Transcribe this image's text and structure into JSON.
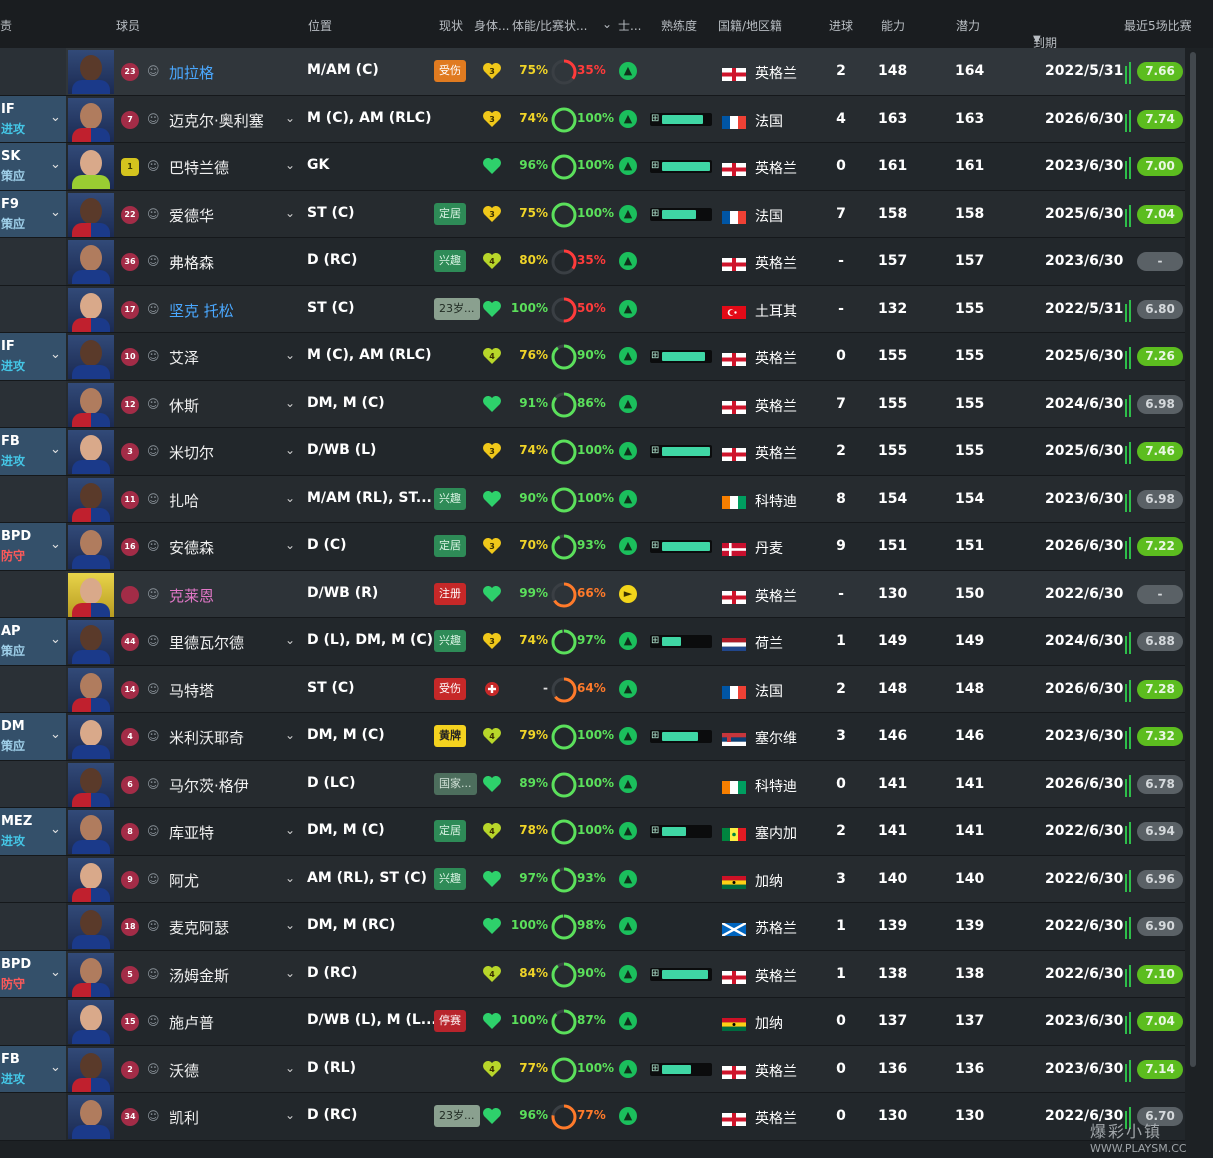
{
  "header": {
    "col_role": "责",
    "col_player": "球员",
    "col_position": "位置",
    "col_status": "现状",
    "col_body": "身体...",
    "col_condition": "体能/比赛状...",
    "col_morale": "士...",
    "col_familiarity": "熟练度",
    "col_nationality": "国籍/地区籍",
    "col_goals": "进球",
    "col_ca": "能力",
    "col_pa": "潜力",
    "col_expiry": "到期",
    "col_last5": "最近5场比赛"
  },
  "colors": {
    "rating_green": "#5cbd1f",
    "rating_grey": "#5a6166",
    "condition_green": "#5be05b",
    "condition_yellow": "#f0d428",
    "sharpness_red": "#ff3b3b",
    "link_blue": "#4aa8ff",
    "loan_pink": "#e077c6"
  },
  "players": [
    {
      "role": "",
      "role_mode": "",
      "number": "23",
      "name": "加拉格",
      "pos": "M/AM (C)",
      "status": "受伤",
      "body": "3",
      "cond": "75%",
      "sharp": "35%",
      "morale": "A",
      "familiarity": 0,
      "flag": "england",
      "nation": "英格兰",
      "goals": "2",
      "ca": "148",
      "pa": "164",
      "expiry": "2022/5/31",
      "rating": "7.66"
    },
    {
      "role": "IF",
      "role_mode": "进攻",
      "number": "7",
      "name": "迈克尔·奥利塞",
      "pos": "M (C), AM (RLC)",
      "status": "",
      "body": "3",
      "cond": "74%",
      "sharp": "100%",
      "morale": "A",
      "familiarity": 0.85,
      "flag": "france",
      "nation": "法国",
      "goals": "4",
      "ca": "163",
      "pa": "163",
      "expiry": "2026/6/30",
      "rating": "7.74"
    },
    {
      "role": "SK",
      "role_mode": "策应",
      "number": "1",
      "name": "巴特兰德",
      "pos": "GK",
      "status": "",
      "body": "",
      "cond": "96%",
      "sharp": "100%",
      "morale": "A",
      "familiarity": 1.0,
      "flag": "england",
      "nation": "英格兰",
      "goals": "0",
      "ca": "161",
      "pa": "161",
      "expiry": "2023/6/30",
      "rating": "7.00"
    },
    {
      "role": "F9",
      "role_mode": "策应",
      "number": "22",
      "name": "爱德华",
      "pos": "ST (C)",
      "status": "定居",
      "body": "3",
      "cond": "75%",
      "sharp": "100%",
      "morale": "A",
      "familiarity": 0.7,
      "flag": "france",
      "nation": "法国",
      "goals": "7",
      "ca": "158",
      "pa": "158",
      "expiry": "2025/6/30",
      "rating": "7.04"
    },
    {
      "role": "",
      "role_mode": "",
      "number": "36",
      "name": "弗格森",
      "pos": "D (RC)",
      "status": "兴趣",
      "body": "4",
      "cond": "80%",
      "sharp": "35%",
      "morale": "A",
      "familiarity": 0,
      "flag": "england",
      "nation": "英格兰",
      "goals": "-",
      "ca": "157",
      "pa": "157",
      "expiry": "2023/6/30",
      "rating": "-"
    },
    {
      "role": "",
      "role_mode": "",
      "number": "17",
      "name": "坚克 托松",
      "pos": "ST (C)",
      "status": "23岁...",
      "body": "",
      "cond": "100%",
      "sharp": "50%",
      "morale": "A",
      "familiarity": 0,
      "flag": "turkey",
      "nation": "土耳其",
      "goals": "-",
      "ca": "132",
      "pa": "155",
      "expiry": "2022/5/31",
      "rating": "6.80"
    },
    {
      "role": "IF",
      "role_mode": "进攻",
      "number": "10",
      "name": "艾泽",
      "pos": "M (C), AM (RLC)",
      "status": "",
      "body": "4",
      "cond": "76%",
      "sharp": "90%",
      "morale": "A",
      "familiarity": 0.9,
      "flag": "england",
      "nation": "英格兰",
      "goals": "0",
      "ca": "155",
      "pa": "155",
      "expiry": "2025/6/30",
      "rating": "7.26"
    },
    {
      "role": "",
      "role_mode": "",
      "number": "12",
      "name": "休斯",
      "pos": "DM, M (C)",
      "status": "",
      "body": "",
      "cond": "91%",
      "sharp": "86%",
      "morale": "A",
      "familiarity": 0,
      "flag": "england",
      "nation": "英格兰",
      "goals": "7",
      "ca": "155",
      "pa": "155",
      "expiry": "2024/6/30",
      "rating": "6.98"
    },
    {
      "role": "FB",
      "role_mode": "进攻",
      "number": "3",
      "name": "米切尔",
      "pos": "D/WB (L)",
      "status": "",
      "body": "3",
      "cond": "74%",
      "sharp": "100%",
      "morale": "A",
      "familiarity": 1.0,
      "flag": "england",
      "nation": "英格兰",
      "goals": "2",
      "ca": "155",
      "pa": "155",
      "expiry": "2025/6/30",
      "rating": "7.46"
    },
    {
      "role": "",
      "role_mode": "",
      "number": "11",
      "name": "扎哈",
      "pos": "M/AM (RL), ST...",
      "status": "兴趣",
      "body": "",
      "cond": "90%",
      "sharp": "100%",
      "morale": "A",
      "familiarity": 0,
      "flag": "ivorycoast",
      "nation": "科特迪",
      "goals": "8",
      "ca": "154",
      "pa": "154",
      "expiry": "2023/6/30",
      "rating": "6.98"
    },
    {
      "role": "BPD",
      "role_mode": "防守",
      "number": "16",
      "name": "安德森",
      "pos": "D (C)",
      "status": "定居",
      "body": "3",
      "cond": "70%",
      "sharp": "93%",
      "morale": "A",
      "familiarity": 1.0,
      "flag": "denmark",
      "nation": "丹麦",
      "goals": "9",
      "ca": "151",
      "pa": "151",
      "expiry": "2026/6/30",
      "rating": "7.22"
    },
    {
      "role": "",
      "role_mode": "",
      "number": "",
      "name": "克莱恩",
      "pos": "D/WB (R)",
      "status": "注册",
      "body": "",
      "cond": "99%",
      "sharp": "66%",
      "morale": "B",
      "familiarity": 0,
      "flag": "england",
      "nation": "英格兰",
      "goals": "-",
      "ca": "130",
      "pa": "150",
      "expiry": "2022/6/30",
      "rating": "-"
    },
    {
      "role": "AP",
      "role_mode": "策应",
      "number": "44",
      "name": "里德瓦尔德",
      "pos": "D (L), DM, M (C)",
      "status": "兴趣",
      "body": "3",
      "cond": "74%",
      "sharp": "97%",
      "morale": "A",
      "familiarity": 0.4,
      "flag": "netherlands",
      "nation": "荷兰",
      "goals": "1",
      "ca": "149",
      "pa": "149",
      "expiry": "2024/6/30",
      "rating": "6.88"
    },
    {
      "role": "",
      "role_mode": "",
      "number": "14",
      "name": "马特塔",
      "pos": "ST (C)",
      "status": "受伤",
      "body": "",
      "cond": "-",
      "sharp": "64%",
      "morale": "A",
      "familiarity": 0,
      "flag": "france",
      "nation": "法国",
      "goals": "2",
      "ca": "148",
      "pa": "148",
      "expiry": "2026/6/30",
      "rating": "7.28"
    },
    {
      "role": "DM",
      "role_mode": "策应",
      "number": "4",
      "name": "米利沃耶奇",
      "pos": "DM, M (C)",
      "status": "黄牌",
      "body": "4",
      "cond": "79%",
      "sharp": "100%",
      "morale": "A",
      "familiarity": 0.75,
      "flag": "serbia",
      "nation": "塞尔维",
      "goals": "3",
      "ca": "146",
      "pa": "146",
      "expiry": "2023/6/30",
      "rating": "7.32"
    },
    {
      "role": "",
      "role_mode": "",
      "number": "6",
      "name": "马尔茨·格伊",
      "pos": "D (LC)",
      "status": "国家...",
      "body": "",
      "cond": "89%",
      "sharp": "100%",
      "morale": "A",
      "familiarity": 0,
      "flag": "ivorycoast",
      "nation": "科特迪",
      "goals": "0",
      "ca": "141",
      "pa": "141",
      "expiry": "2026/6/30",
      "rating": "6.78"
    },
    {
      "role": "MEZ",
      "role_mode": "进攻",
      "number": "8",
      "name": "库亚特",
      "pos": "DM, M (C)",
      "status": "定居",
      "body": "4",
      "cond": "78%",
      "sharp": "100%",
      "morale": "A",
      "familiarity": 0.5,
      "flag": "senegal",
      "nation": "塞内加",
      "goals": "2",
      "ca": "141",
      "pa": "141",
      "expiry": "2022/6/30",
      "rating": "6.94"
    },
    {
      "role": "",
      "role_mode": "",
      "number": "9",
      "name": "阿尤",
      "pos": "AM (RL), ST (C)",
      "status": "兴趣",
      "body": "",
      "cond": "97%",
      "sharp": "93%",
      "morale": "A",
      "familiarity": 0,
      "flag": "ghana",
      "nation": "加纳",
      "goals": "3",
      "ca": "140",
      "pa": "140",
      "expiry": "2022/6/30",
      "rating": "6.96"
    },
    {
      "role": "",
      "role_mode": "",
      "number": "18",
      "name": "麦克阿瑟",
      "pos": "DM, M (RC)",
      "status": "",
      "body": "",
      "cond": "100%",
      "sharp": "98%",
      "morale": "A",
      "familiarity": 0,
      "flag": "scotland",
      "nation": "苏格兰",
      "goals": "1",
      "ca": "139",
      "pa": "139",
      "expiry": "2022/6/30",
      "rating": "6.90"
    },
    {
      "role": "BPD",
      "role_mode": "防守",
      "number": "5",
      "name": "汤姆金斯",
      "pos": "D (RC)",
      "status": "",
      "body": "4",
      "cond": "84%",
      "sharp": "90%",
      "morale": "A",
      "familiarity": 0.95,
      "flag": "england",
      "nation": "英格兰",
      "goals": "1",
      "ca": "138",
      "pa": "138",
      "expiry": "2022/6/30",
      "rating": "7.10"
    },
    {
      "role": "",
      "role_mode": "",
      "number": "15",
      "name": "施卢普",
      "pos": "D/WB (L), M (L...",
      "status": "停赛",
      "body": "",
      "cond": "100%",
      "sharp": "87%",
      "morale": "A",
      "familiarity": 0,
      "flag": "ghana",
      "nation": "加纳",
      "goals": "0",
      "ca": "137",
      "pa": "137",
      "expiry": "2023/6/30",
      "rating": "7.04"
    },
    {
      "role": "FB",
      "role_mode": "进攻",
      "number": "2",
      "name": "沃德",
      "pos": "D (RL)",
      "status": "",
      "body": "4",
      "cond": "77%",
      "sharp": "100%",
      "morale": "A",
      "familiarity": 0.6,
      "flag": "england",
      "nation": "英格兰",
      "goals": "0",
      "ca": "136",
      "pa": "136",
      "expiry": "2023/6/30",
      "rating": "7.14"
    },
    {
      "role": "",
      "role_mode": "",
      "number": "34",
      "name": "凯利",
      "pos": "D (RC)",
      "status": "23岁...",
      "body": "",
      "cond": "96%",
      "sharp": "77%",
      "morale": "A",
      "familiarity": 0,
      "flag": "england",
      "nation": "英格兰",
      "goals": "0",
      "ca": "130",
      "pa": "130",
      "expiry": "2022/6/30",
      "rating": "6.70"
    }
  ],
  "watermark": {
    "text": "爆彩小镇",
    "url": "WWW.PLAYSM.CC"
  }
}
